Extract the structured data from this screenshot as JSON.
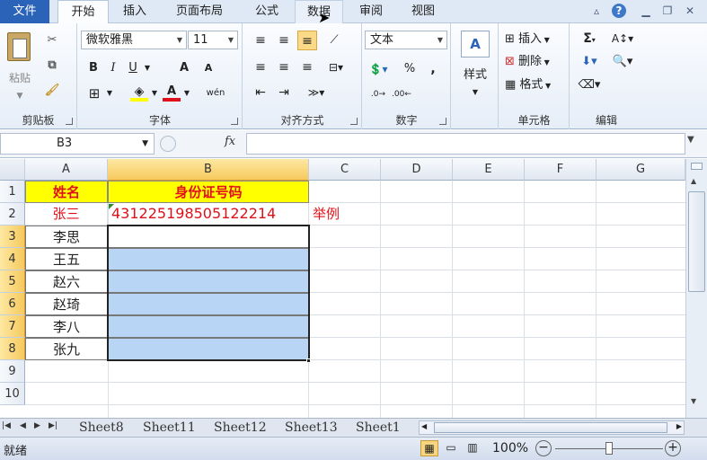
{
  "tabs": {
    "file": "文件",
    "home": "开始",
    "insert": "插入",
    "layout": "页面布局",
    "formulas": "公式",
    "data": "数据",
    "review": "审阅",
    "view": "视图"
  },
  "ribbon": {
    "clipboard": {
      "label": "剪贴板",
      "paste": "粘贴"
    },
    "font": {
      "label": "字体",
      "name": "微软雅黑",
      "size": "11",
      "bold": "B",
      "italic": "I",
      "underline": "U",
      "grow": "A",
      "shrink": "A",
      "color_letter": "A",
      "wen": "wén"
    },
    "align": {
      "label": "对齐方式"
    },
    "number": {
      "label": "数字",
      "format": "文本",
      "percent": "%",
      "comma": ","
    },
    "styles": {
      "label": "样式"
    },
    "cells": {
      "label": "单元格",
      "insert": "插入",
      "delete": "删除",
      "format": "格式"
    },
    "editing": {
      "label": "编辑",
      "sigma": "Σ"
    }
  },
  "formula_bar": {
    "name_box": "B3",
    "fx": "fx",
    "value": ""
  },
  "grid": {
    "columns": [
      "A",
      "B",
      "C",
      "D",
      "E",
      "F",
      "G"
    ],
    "rows": [
      "1",
      "2",
      "3",
      "4",
      "5",
      "6",
      "7",
      "8",
      "9",
      "10"
    ],
    "cells": {
      "a1": "姓名",
      "b1": "身份证号码",
      "a2": "张三",
      "b2": "431225198505122214",
      "c2": "举例",
      "a3": "李思",
      "a4": "王五",
      "a5": "赵六",
      "a6": "赵琦",
      "a7": "李八",
      "a8": "张九"
    },
    "colors": {
      "header_fill": "#ffff00",
      "header_text": "#e0101a",
      "example_text": "#e0101a",
      "selection_fill": "#b8d5f5"
    }
  },
  "sheets": [
    "Sheet8",
    "Sheet11",
    "Sheet12",
    "Sheet13",
    "Sheet1"
  ],
  "status": {
    "ready": "就绪",
    "zoom": "100%"
  }
}
